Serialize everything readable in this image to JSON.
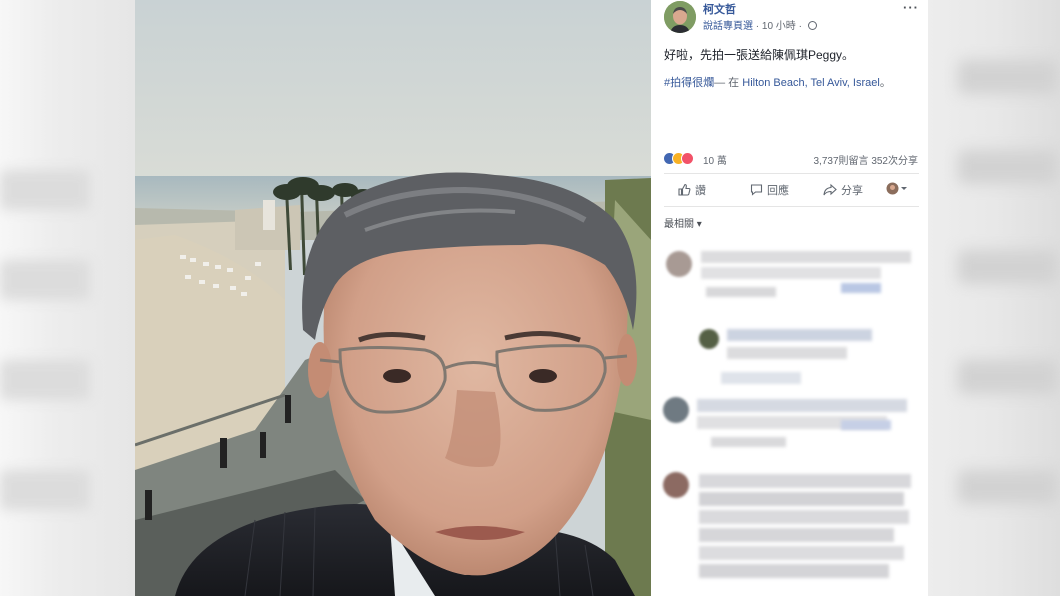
{
  "post": {
    "author": "柯文哲",
    "page_link": "說話專頁選",
    "time": "· 10 小時 ·",
    "more": "···",
    "text": "好啦，先拍一張送給陳佩琪Peggy。",
    "hashtag": "#拍得很爛",
    "location_sep": "— 在",
    "location": "Hilton Beach, Tel Aviv, Israel",
    "location_suffix": "。",
    "reactions_count": "10 萬",
    "comments_count": "3,737則留言",
    "shares_count": "352次分享"
  },
  "actions": {
    "like": "讚",
    "comment": "回應",
    "share": "分享"
  },
  "comments": {
    "sort_label": "最相關 ▾"
  },
  "colors": {
    "facebook_blue": "#365899",
    "like_blue": "#4267b2",
    "haha_yellow": "#f7b125",
    "love_red": "#f25268"
  },
  "icons": [
    "more-options-icon",
    "globe-icon",
    "like-icon",
    "comment-icon",
    "share-icon",
    "audience-icon"
  ]
}
